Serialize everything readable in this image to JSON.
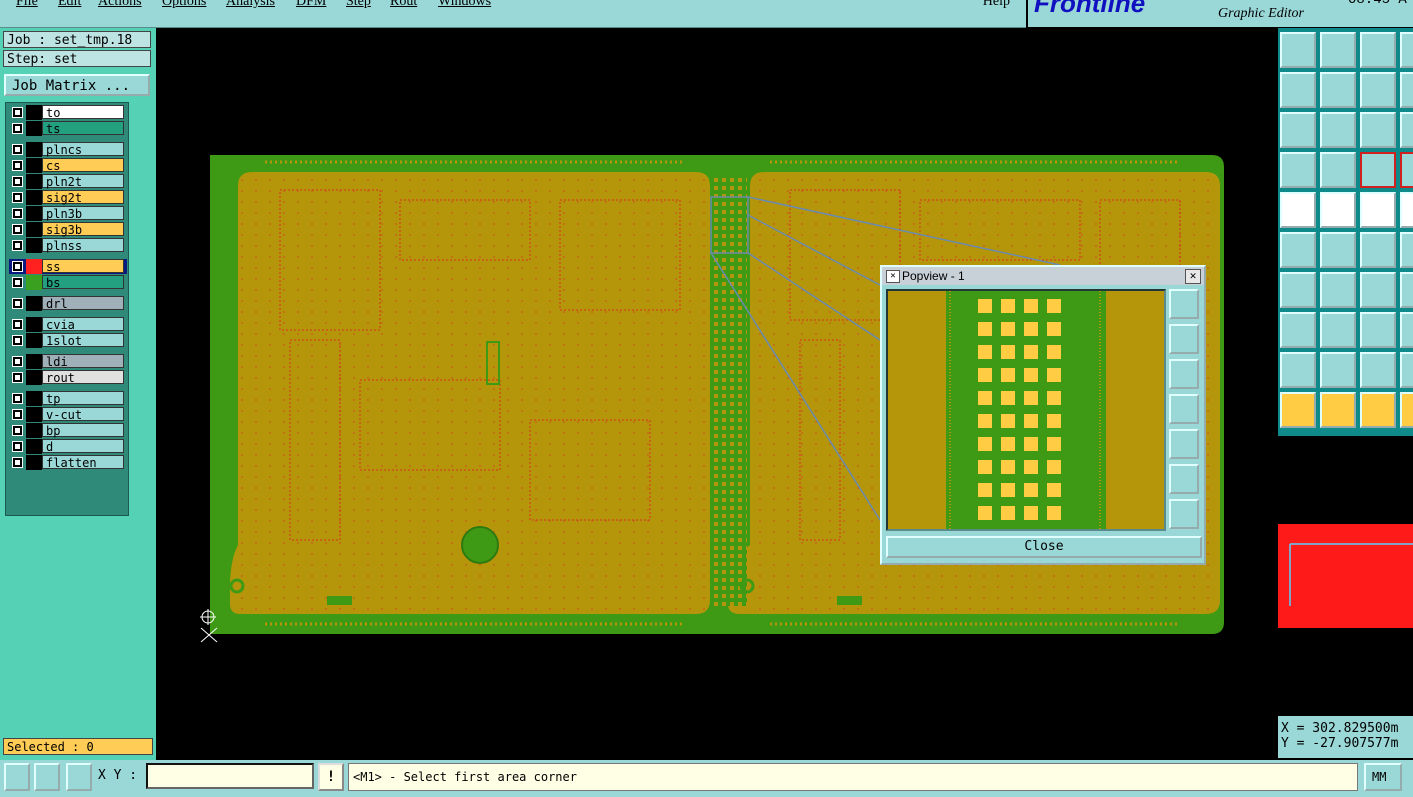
{
  "menu": {
    "items": [
      "File",
      "Edit",
      "Actions",
      "Options",
      "Analysis",
      "DFM",
      "Step",
      "Rout",
      "Windows"
    ],
    "help": "Help"
  },
  "brand": {
    "logo": "Frontline",
    "subtitle": "Graphic Editor",
    "clock": "08:45 A"
  },
  "job": {
    "job_label": "Job : set_tmp.18",
    "step_label": "Step: set",
    "matrix_button": "Job Matrix ..."
  },
  "layers": [
    {
      "name": "to",
      "color": "#ffffff",
      "swatch": "#000000"
    },
    {
      "name": "ts",
      "color": "#22a080",
      "swatch": "#000000"
    },
    {
      "name": "plncs",
      "color": "#9ad8d8",
      "swatch": "#000000"
    },
    {
      "name": "cs",
      "color": "#ffcc55",
      "swatch": "#000000"
    },
    {
      "name": "pln2t",
      "color": "#9ad8d8",
      "swatch": "#000000"
    },
    {
      "name": "sig2t",
      "color": "#ffcc55",
      "swatch": "#000000"
    },
    {
      "name": "pln3b",
      "color": "#9ad8d8",
      "swatch": "#000000"
    },
    {
      "name": "sig3b",
      "color": "#ffcc55",
      "swatch": "#000000"
    },
    {
      "name": "plnss",
      "color": "#9ad8d8",
      "swatch": "#000000"
    },
    {
      "name": "ss",
      "color": "#ffcc55",
      "swatch": "#ff2020",
      "active": true
    },
    {
      "name": "bs",
      "color": "#22a080",
      "swatch": "#3aa020"
    },
    {
      "name": "drl",
      "color": "#a0b0b8",
      "swatch": "#000000"
    },
    {
      "name": "cvia",
      "color": "#9ad8d8",
      "swatch": "#000000"
    },
    {
      "name": "1slot",
      "color": "#9ad8d8",
      "swatch": "#000000"
    },
    {
      "name": "ldi",
      "color": "#a0b0b8",
      "swatch": "#000000"
    },
    {
      "name": "rout",
      "color": "#e0e0e0",
      "swatch": "#000000"
    },
    {
      "name": "tp",
      "color": "#9ad8d8",
      "swatch": "#000000"
    },
    {
      "name": "v-cut",
      "color": "#9ad8d8",
      "swatch": "#000000"
    },
    {
      "name": "bp",
      "color": "#9ad8d8",
      "swatch": "#000000"
    },
    {
      "name": "d",
      "color": "#9ad8d8",
      "swatch": "#000000"
    },
    {
      "name": "flatten",
      "color": "#9ad8d8",
      "swatch": "#000000"
    }
  ],
  "selected_label": "Selected : 0",
  "popview": {
    "title": "Popview - 1",
    "close_label": "Close"
  },
  "status": {
    "xy_label": "X Y :",
    "xy_value": "",
    "bang": "!",
    "prompt": "<M1> - Select first area corner",
    "unit": "MM"
  },
  "coords": {
    "x": "X = 302.829500m",
    "y": "Y = -27.907577m"
  },
  "colors": {
    "board_copper": "#b5960a",
    "board_green": "#3e9a14",
    "trace_red": "#d83020",
    "panel_teal": "#55d1b6",
    "ui_cyan": "#9ad8d8"
  }
}
